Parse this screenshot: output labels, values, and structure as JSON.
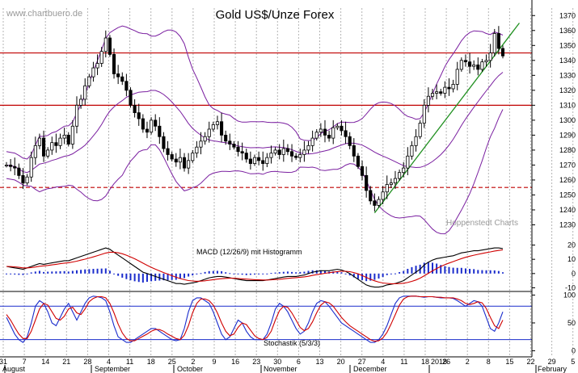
{
  "title": "Gold US$/Unze Forex",
  "watermark_left": "www.chartbuero.de",
  "watermark_right": "Hoppenstedt Charts",
  "colors": {
    "background": "#ffffff",
    "grid": "#b4b4b4",
    "candle": "#000000",
    "bollinger": "#7a1fa0",
    "resistance": "#c00000",
    "trendline": "#209020",
    "macd_line": "#000000",
    "signal_line": "#d00000",
    "histogram": "#1a2ccc",
    "stoch_k": "#1a2ccc",
    "stoch_d": "#d00000",
    "stoch_levels": "#1a2ccc"
  },
  "chart_data": [
    {
      "type": "candlestick",
      "title": "Gold US$/Unze Forex",
      "ylim": [
        1220,
        1375
      ],
      "y_ticks": [
        1230,
        1240,
        1250,
        1260,
        1270,
        1280,
        1290,
        1300,
        1310,
        1320,
        1330,
        1340,
        1350,
        1360,
        1370
      ],
      "x_tick_labels": [
        "31",
        "7",
        "14",
        "21",
        "28",
        "4",
        "11",
        "18",
        "25",
        "2",
        "9",
        "16",
        "23",
        "30",
        "6",
        "13",
        "20",
        "27",
        "4",
        "11",
        "18",
        "26",
        "2",
        "8",
        "15",
        "22",
        "29",
        "5"
      ],
      "month_labels": [
        "August",
        "September",
        "October",
        "November",
        "December",
        "2018",
        "January",
        "February"
      ],
      "closes": [
        1270,
        1269,
        1268,
        1263,
        1258,
        1262,
        1275,
        1283,
        1288,
        1276,
        1280,
        1285,
        1283,
        1288,
        1290,
        1284,
        1296,
        1310,
        1314,
        1323,
        1329,
        1335,
        1338,
        1346,
        1355,
        1344,
        1331,
        1329,
        1326,
        1320,
        1310,
        1305,
        1301,
        1294,
        1292,
        1300,
        1296,
        1289,
        1281,
        1277,
        1274,
        1272,
        1275,
        1268,
        1273,
        1278,
        1282,
        1286,
        1289,
        1294,
        1297,
        1299,
        1290,
        1286,
        1284,
        1282,
        1279,
        1278,
        1274,
        1271,
        1275,
        1273,
        1271,
        1275,
        1278,
        1280,
        1277,
        1281,
        1279,
        1276,
        1275,
        1277,
        1280,
        1283,
        1288,
        1292,
        1294,
        1290,
        1288,
        1295,
        1296,
        1293,
        1289,
        1283,
        1276,
        1269,
        1263,
        1253,
        1246,
        1243,
        1247,
        1252,
        1257,
        1258,
        1261,
        1265,
        1268,
        1276,
        1283,
        1289,
        1298,
        1310,
        1316,
        1318,
        1319,
        1318,
        1322,
        1321,
        1324,
        1334,
        1340,
        1339,
        1336,
        1337,
        1334,
        1339,
        1340,
        1345,
        1358,
        1348,
        1343
      ],
      "resistance_levels": [
        1345,
        1310
      ],
      "support_level": 1255,
      "bollinger_bands": "upper, middle and lower band",
      "trendline": "rising support line from December low"
    },
    {
      "type": "line",
      "title": "MACD (12/26/9) mit Histogramm",
      "ylim": [
        -12,
        22
      ],
      "y_ticks": [
        20,
        10,
        0,
        -10
      ],
      "macd": [
        5,
        4.5,
        4,
        3.5,
        3,
        4,
        5,
        6,
        7,
        6.5,
        7,
        7.5,
        8,
        8.5,
        9,
        9,
        10,
        11,
        12,
        13,
        14,
        15,
        16,
        17,
        18,
        17,
        15,
        13,
        11,
        9,
        7,
        5,
        3,
        1,
        0,
        -1,
        -2,
        -3,
        -4,
        -5,
        -6,
        -7,
        -7,
        -7.5,
        -7,
        -6.5,
        -6,
        -5,
        -4,
        -3,
        -2.5,
        -2,
        -2,
        -2.5,
        -3,
        -3.5,
        -4,
        -4.5,
        -5,
        -5,
        -5,
        -5,
        -5,
        -4.5,
        -4,
        -3.5,
        -3,
        -2.5,
        -2,
        -2,
        -2,
        -1.5,
        -1,
        0,
        1,
        1.5,
        2,
        2,
        2,
        2.5,
        3,
        2.5,
        1.5,
        0,
        -2,
        -4,
        -6,
        -8,
        -9,
        -9.5,
        -9.5,
        -9,
        -8,
        -7.5,
        -7,
        -6,
        -5,
        -3,
        -1,
        1,
        3,
        6,
        8,
        9.5,
        10.5,
        11,
        11.5,
        12,
        12.5,
        13.5,
        14.5,
        15,
        15.5,
        16,
        16,
        16.5,
        17,
        17.5,
        18,
        18,
        17.5
      ],
      "signal": [
        5,
        4.9,
        4.7,
        4.4,
        4,
        4,
        4.2,
        4.6,
        5.1,
        5.4,
        5.7,
        6.1,
        6.5,
        6.9,
        7.3,
        7.6,
        8.1,
        8.7,
        9.4,
        10.1,
        10.9,
        11.7,
        12.6,
        13.5,
        14.4,
        15,
        15,
        14.6,
        13.9,
        12.9,
        11.7,
        10.4,
        8.9,
        7.3,
        5.8,
        4.4,
        3.1,
        1.9,
        0.7,
        -0.4,
        -1.5,
        -2.6,
        -3.5,
        -4.3,
        -4.9,
        -5.2,
        -5.4,
        -5.3,
        -5.1,
        -4.7,
        -4.3,
        -3.9,
        -3.6,
        -3.4,
        -3.3,
        -3.3,
        -3.5,
        -3.7,
        -3.9,
        -4.1,
        -4.3,
        -4.4,
        -4.5,
        -4.5,
        -4.4,
        -4.2,
        -4,
        -3.7,
        -3.4,
        -3.1,
        -2.9,
        -2.6,
        -2.3,
        -1.9,
        -1.3,
        -0.8,
        -0.3,
        0.2,
        0.6,
        1,
        1.4,
        1.6,
        1.6,
        1.3,
        0.7,
        -0.2,
        -1.4,
        -2.7,
        -4,
        -5.1,
        -6,
        -6.6,
        -6.9,
        -7.1,
        -7.1,
        -7,
        -6.8,
        -6.3,
        -5.5,
        -4.5,
        -3.2,
        -1.6,
        0.2,
        1.9,
        3.5,
        5,
        6.3,
        7.4,
        8.4,
        9.5,
        10.5,
        11.4,
        12.2,
        12.9,
        13.5,
        14.1,
        14.7,
        15.2,
        15.8,
        16.2,
        16.6
      ]
    },
    {
      "type": "line",
      "title": "Stochastik (5/3/3)",
      "ylim": [
        -8,
        105
      ],
      "y_ticks": [
        100,
        50,
        0
      ],
      "levels": [
        80,
        20
      ],
      "k_line": [
        60,
        45,
        30,
        20,
        15,
        25,
        50,
        80,
        90,
        85,
        70,
        50,
        45,
        60,
        75,
        85,
        70,
        55,
        70,
        85,
        95,
        98,
        97,
        95,
        90,
        70,
        45,
        25,
        20,
        15,
        15,
        20,
        25,
        30,
        35,
        40,
        40,
        35,
        30,
        25,
        20,
        18,
        20,
        40,
        70,
        90,
        95,
        95,
        90,
        85,
        70,
        50,
        30,
        20,
        25,
        40,
        55,
        50,
        35,
        25,
        20,
        20,
        20,
        30,
        50,
        75,
        85,
        80,
        70,
        55,
        40,
        30,
        35,
        50,
        70,
        85,
        90,
        88,
        80,
        70,
        60,
        50,
        45,
        40,
        35,
        30,
        25,
        20,
        15,
        15,
        20,
        30,
        45,
        65,
        85,
        95,
        98,
        98,
        98,
        98,
        97,
        96,
        97,
        97,
        96,
        95,
        95,
        95,
        94,
        90,
        85,
        80,
        85,
        90,
        88,
        80,
        60,
        40,
        35,
        50,
        70
      ],
      "d_line": [
        65,
        55,
        42,
        30,
        22,
        22,
        35,
        55,
        75,
        85,
        82,
        70,
        58,
        55,
        62,
        75,
        78,
        68,
        65,
        75,
        88,
        94,
        97,
        97,
        95,
        85,
        68,
        48,
        32,
        22,
        18,
        18,
        22,
        26,
        30,
        35,
        38,
        38,
        35,
        30,
        26,
        22,
        20,
        28,
        45,
        68,
        85,
        93,
        93,
        90,
        82,
        68,
        50,
        35,
        27,
        30,
        42,
        50,
        47,
        37,
        27,
        22,
        20,
        24,
        35,
        55,
        72,
        80,
        78,
        68,
        55,
        42,
        36,
        40,
        52,
        68,
        82,
        88,
        86,
        80,
        70,
        60,
        52,
        45,
        40,
        35,
        30,
        25,
        20,
        17,
        18,
        23,
        33,
        48,
        65,
        82,
        93,
        97,
        98,
        98,
        97,
        97,
        97,
        97,
        96,
        96,
        95,
        95,
        95,
        93,
        90,
        85,
        83,
        85,
        88,
        86,
        76,
        60,
        45,
        40,
        55
      ]
    }
  ]
}
